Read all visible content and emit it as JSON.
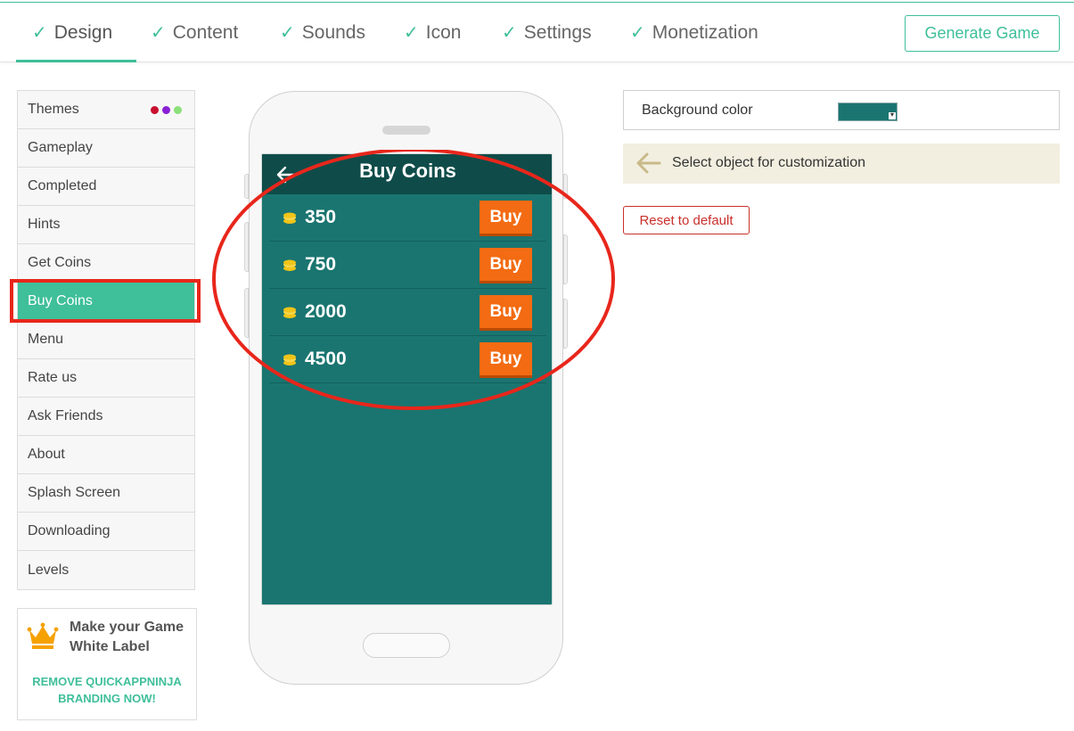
{
  "tabs": [
    {
      "label": "Design"
    },
    {
      "label": "Content"
    },
    {
      "label": "Sounds"
    },
    {
      "label": "Icon"
    },
    {
      "label": "Settings"
    },
    {
      "label": "Monetization"
    }
  ],
  "generate_label": "Generate Game",
  "check_glyph": "✓",
  "menu": {
    "items": [
      {
        "label": "Themes"
      },
      {
        "label": "Gameplay"
      },
      {
        "label": "Completed"
      },
      {
        "label": "Hints"
      },
      {
        "label": "Get Coins"
      },
      {
        "label": "Buy Coins"
      },
      {
        "label": "Menu"
      },
      {
        "label": "Rate us"
      },
      {
        "label": "Ask Friends"
      },
      {
        "label": "About"
      },
      {
        "label": "Splash Screen"
      },
      {
        "label": "Downloading"
      },
      {
        "label": "Levels"
      }
    ],
    "active_index": 5,
    "theme_dot_colors": [
      "#c8102e",
      "#8a1fd6",
      "#8be07a"
    ]
  },
  "promo": {
    "title": "Make your Game White Label",
    "link": "REMOVE QUICKAPPNINJA BRANDING NOW!"
  },
  "phone": {
    "screen_title": "Buy Coins",
    "coin_packs": [
      {
        "amount": "350",
        "button": "Buy"
      },
      {
        "amount": "750",
        "button": "Buy"
      },
      {
        "amount": "2000",
        "button": "Buy"
      },
      {
        "amount": "4500",
        "button": "Buy"
      }
    ]
  },
  "settings": {
    "background_label": "Background color",
    "background_color": "#1a7570",
    "hint": "Select object for customization",
    "reset_label": "Reset to default"
  },
  "colors": {
    "accent": "#3fbf9a",
    "buy_button": "#f36b12",
    "annotation": "#e8261b"
  }
}
